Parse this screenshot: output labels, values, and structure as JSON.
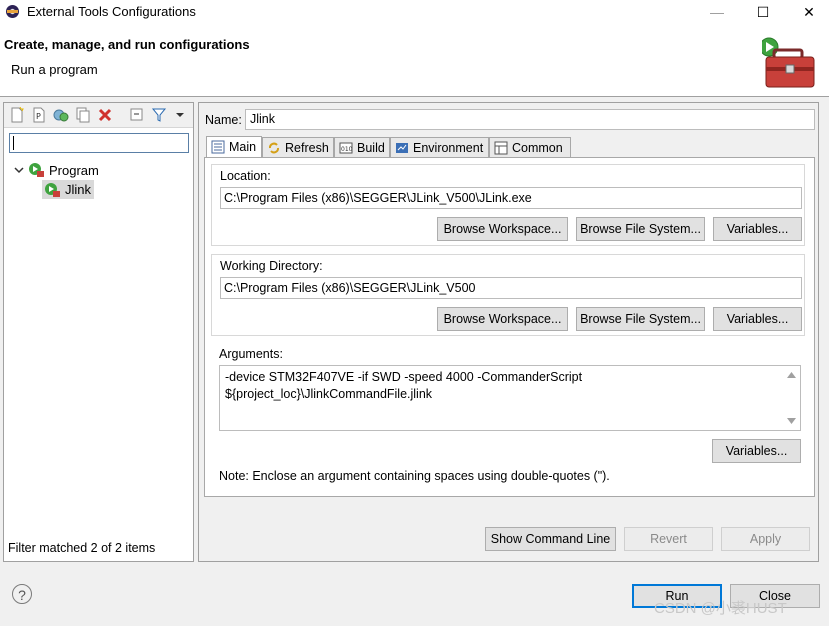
{
  "window": {
    "title": "External Tools Configurations",
    "minimize": "—",
    "maximize": "☐",
    "close": "✕"
  },
  "header": {
    "title": "Create, manage, and run configurations",
    "subtitle": "Run a program"
  },
  "left": {
    "filter_value": "",
    "tree": [
      {
        "label": "Program",
        "expanded": true
      },
      {
        "label": "Jlink",
        "selected": true
      }
    ],
    "status": "Filter matched 2 of 2 items"
  },
  "config": {
    "name_label": "Name:",
    "name_value": "Jlink",
    "tabs": [
      "Main",
      "Refresh",
      "Build",
      "Environment",
      "Common"
    ],
    "active_tab": "Main",
    "location": {
      "label": "Location:",
      "value": "C:\\Program Files (x86)\\SEGGER\\JLink_V500\\JLink.exe"
    },
    "working_dir": {
      "label": "Working Directory:",
      "value": "C:\\Program Files (x86)\\SEGGER\\JLink_V500"
    },
    "arguments": {
      "label": "Arguments:",
      "line1": "-device STM32F407VE -if SWD -speed 4000 -CommanderScript",
      "line2": "${project_loc}\\JlinkCommandFile.jlink"
    },
    "browse_workspace": "Browse Workspace...",
    "browse_fs": "Browse File System...",
    "variables": "Variables...",
    "note": "Note: Enclose an argument containing spaces using double-quotes (\")."
  },
  "buttons": {
    "show_cmd": "Show Command Line",
    "revert": "Revert",
    "apply": "Apply",
    "run": "Run",
    "close": "Close"
  },
  "help": "?",
  "watermark": "CSDN @小裘HUST",
  "colors": {
    "accent": "#0078d7",
    "selection": "#cce8ff"
  }
}
